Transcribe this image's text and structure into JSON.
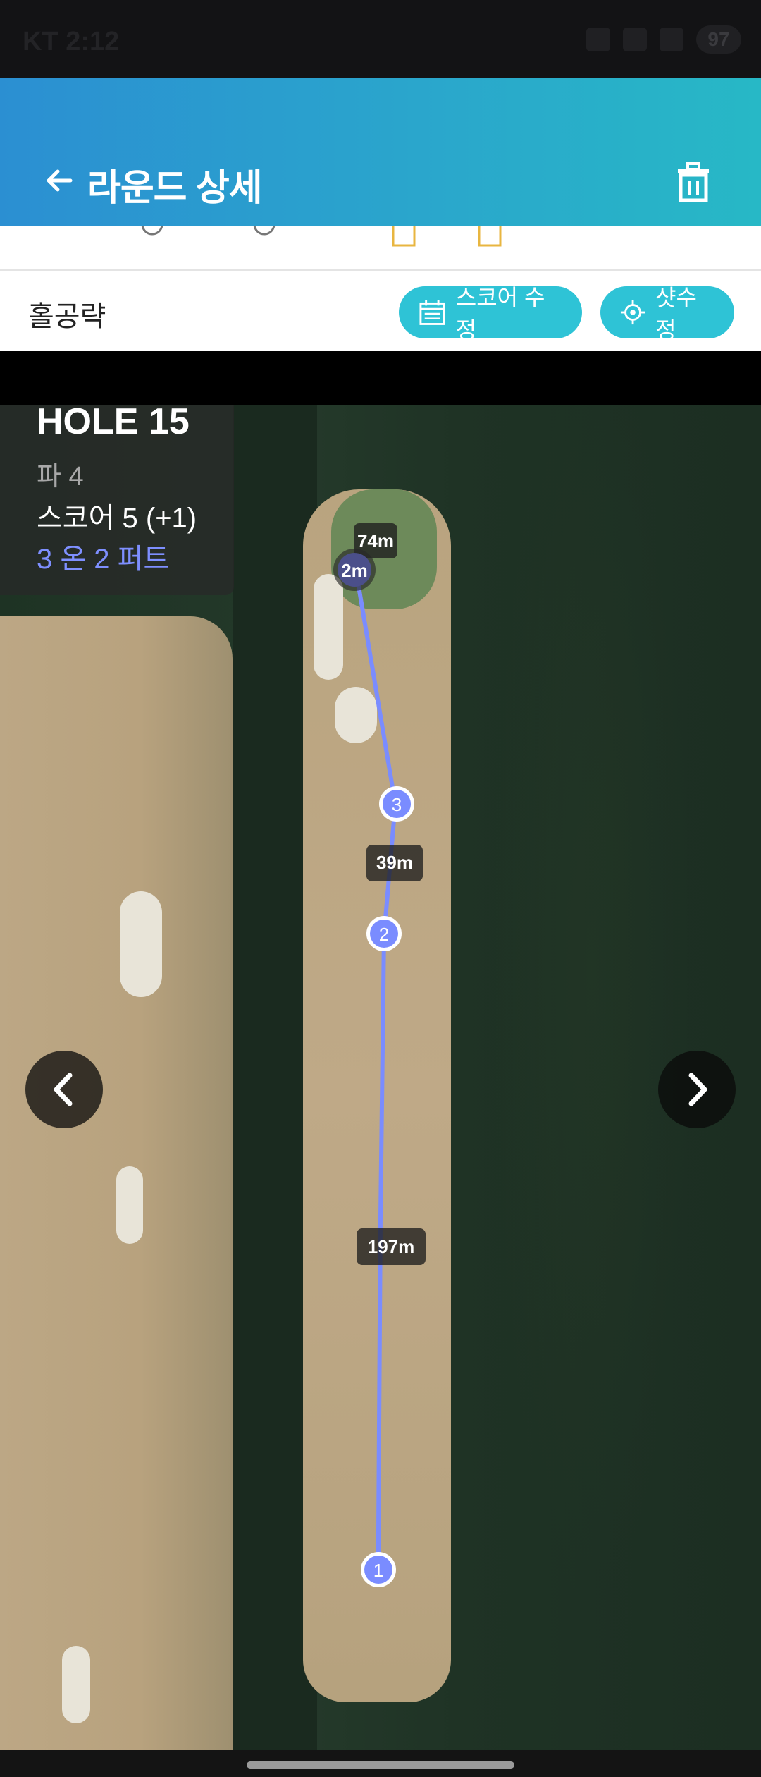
{
  "status_bar": {
    "carrier_time": "KT 2:12",
    "battery": "97"
  },
  "app_bar": {
    "title": "라운드 상세",
    "back_icon": "arrow-left-icon",
    "delete_icon": "trash-icon"
  },
  "toolbar": {
    "section_label": "홀공략",
    "score_edit_label": "스코어 수정",
    "shot_edit_label": "샷수정",
    "score_icon": "calendar-icon",
    "shot_icon": "crosshair-icon"
  },
  "hole_info": {
    "title": "HOLE 15",
    "par": "파 4",
    "score": "스코어 5 (+1)",
    "putts": "3 온 2 퍼트"
  },
  "shots": {
    "markers": [
      "1",
      "2",
      "3"
    ],
    "green_distance": "2m",
    "distances": [
      "197m",
      "39m",
      "74m"
    ]
  },
  "nav": {
    "prev_icon": "chevron-left-icon",
    "next_icon": "chevron-right-icon"
  },
  "colors": {
    "header_start": "#2b8fd2",
    "header_end": "#27b8c6",
    "pill": "#2ec3d6",
    "shot_line": "#7a8cff",
    "putt_text": "#7e8fff"
  }
}
